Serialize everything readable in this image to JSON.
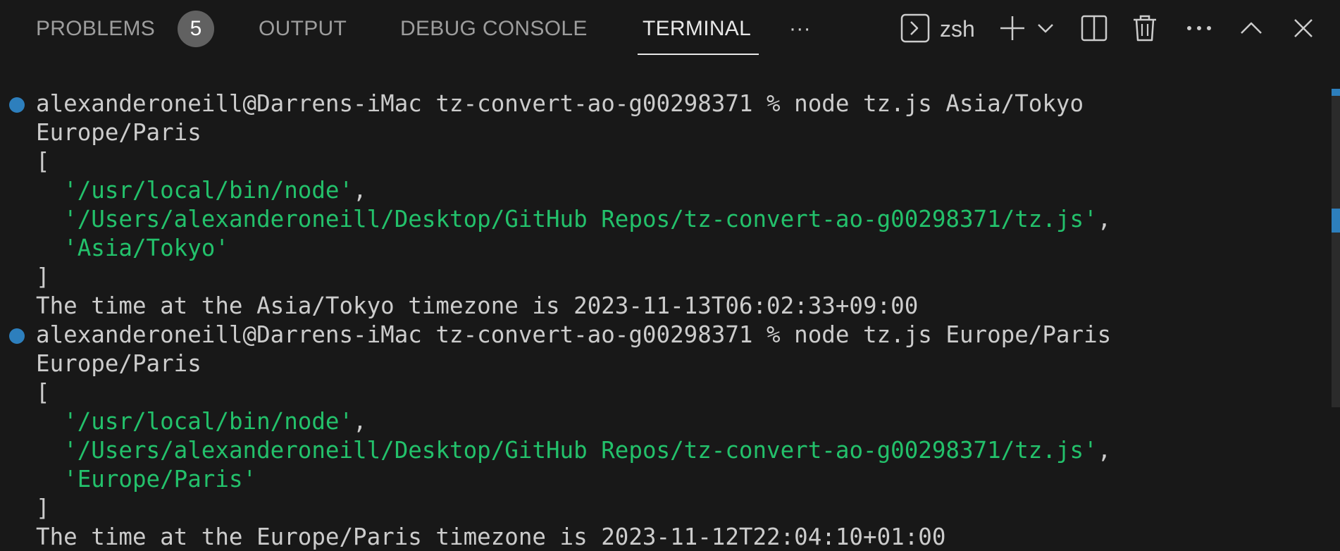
{
  "tabs": {
    "problems": "PROBLEMS",
    "problems_count": "5",
    "output": "OUTPUT",
    "debug_console": "DEBUG CONSOLE",
    "terminal": "TERMINAL",
    "more": "···"
  },
  "toolbar": {
    "shell_name": "zsh",
    "icons": [
      "terminal-icon",
      "plus-icon",
      "chevron-down-icon",
      "split-icon",
      "trash-icon",
      "more-icon",
      "chevron-up-icon",
      "close-icon"
    ]
  },
  "terminal": {
    "lines": [
      {
        "text": "alexanderoneill@Darrens-iMac tz-convert-ao-g00298371 % node tz.js Asia/Tokyo"
      },
      {
        "text": "Europe/Paris"
      },
      {
        "text": "["
      },
      {
        "pre": "  ",
        "str": "'/usr/local/bin/node'",
        "post": ","
      },
      {
        "pre": "  ",
        "str": "'/Users/alexanderoneill/Desktop/GitHub Repos/tz-convert-ao-g00298371/tz.js'",
        "post": ","
      },
      {
        "pre": "  ",
        "str": "'Asia/Tokyo'",
        "post": ""
      },
      {
        "text": "]"
      },
      {
        "text": "The time at the Asia/Tokyo timezone is 2023-11-13T06:02:33+09:00"
      },
      {
        "text": "alexanderoneill@Darrens-iMac tz-convert-ao-g00298371 % node tz.js Europe/Paris"
      },
      {
        "text": "Europe/Paris"
      },
      {
        "text": "["
      },
      {
        "pre": "  ",
        "str": "'/usr/local/bin/node'",
        "post": ","
      },
      {
        "pre": "  ",
        "str": "'/Users/alexanderoneill/Desktop/GitHub Repos/tz-convert-ao-g00298371/tz.js'",
        "post": ","
      },
      {
        "pre": "  ",
        "str": "'Europe/Paris'",
        "post": ""
      },
      {
        "text": "]"
      },
      {
        "text": "The time at the Europe/Paris timezone is 2023-11-12T22:04:10+01:00"
      }
    ]
  },
  "colors": {
    "background": "#181818",
    "string": "#23c16b",
    "prompt_dot": "#2d7fbd",
    "text": "#cccccc"
  }
}
